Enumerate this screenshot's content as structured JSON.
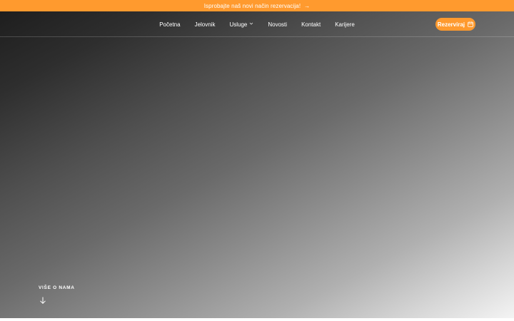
{
  "promo": {
    "text": "Isprobajte naš novi način rezervacija!",
    "arrow": "→",
    "color": "#ff9a2e"
  },
  "nav": {
    "items": [
      {
        "label": "Početna"
      },
      {
        "label": "Jelovnik"
      },
      {
        "label": "Usluge",
        "has_dropdown": true,
        "chevron": "⌄"
      },
      {
        "label": "Novosti"
      },
      {
        "label": "Kontakt"
      },
      {
        "label": "Karijere"
      }
    ],
    "reserve_label": "Rezerviraj",
    "reserve_icon": "calendar-icon",
    "accent": "#ff9a2e"
  },
  "hero": {
    "more_label": "VIŠE O NAMA",
    "more_icon": "arrow-down-icon"
  }
}
